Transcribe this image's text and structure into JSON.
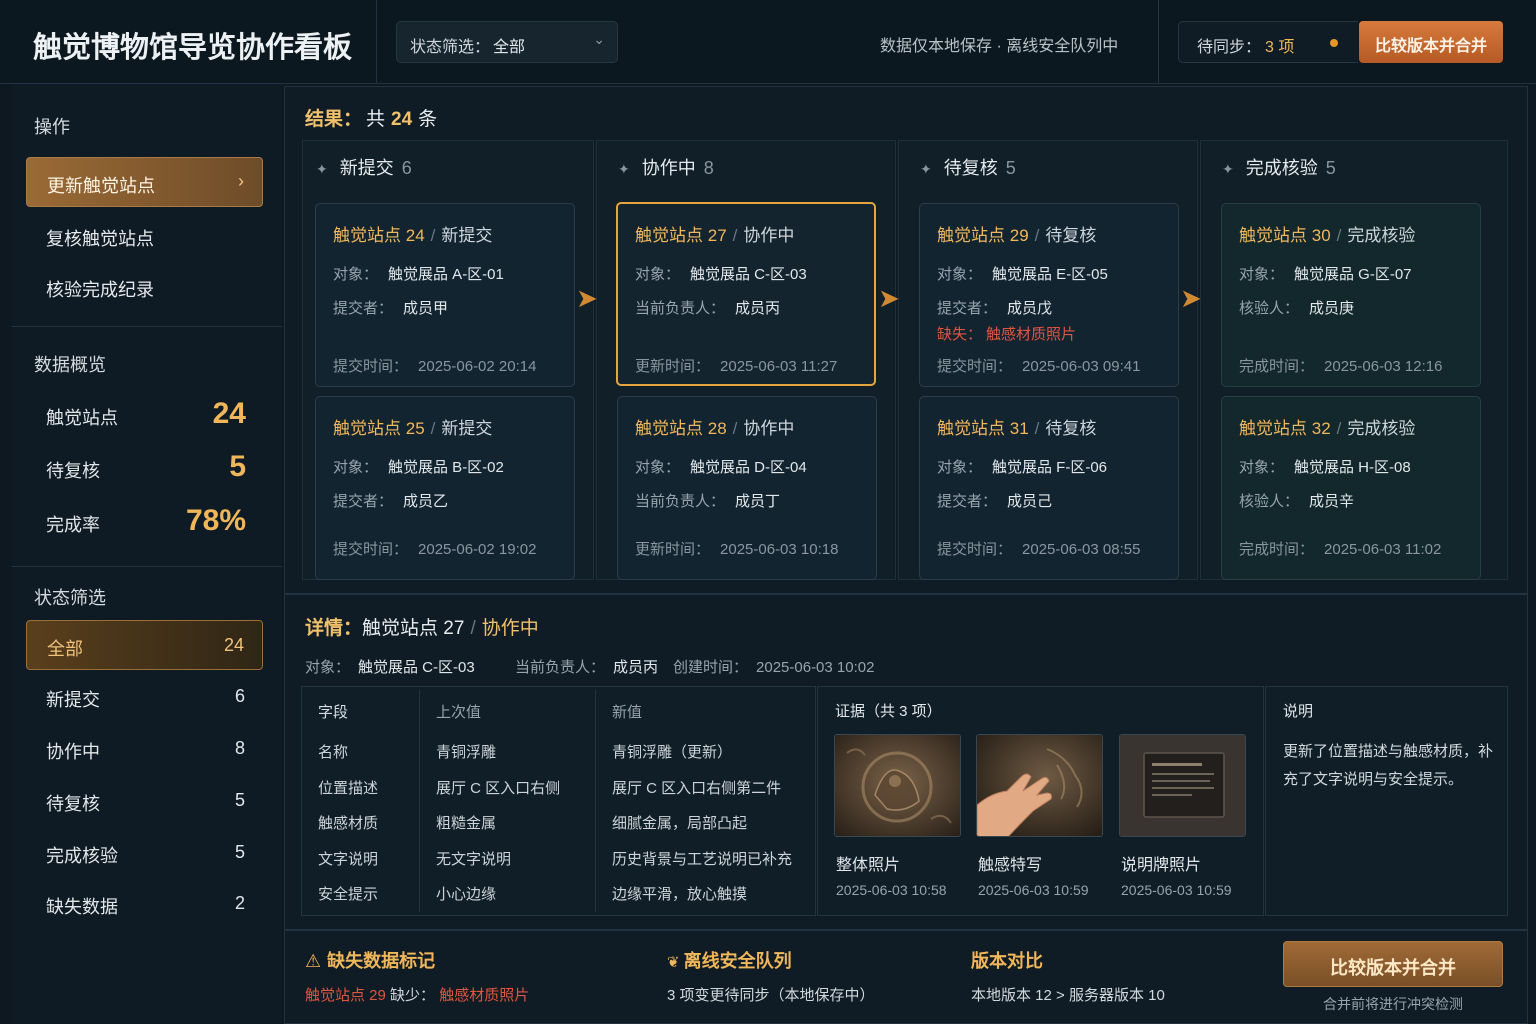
{
  "app": {
    "title": "触觉博物馆导览协作看板"
  },
  "topbar": {
    "filter_label": "状态筛选：",
    "filter_value": "全部",
    "notice": "数据仅本地保存 · 离线安全队列中",
    "pending_label": "待同步：",
    "pending_count": "3 项",
    "compare_button": "比较版本并合并"
  },
  "sidebar": {
    "actions_title": "操作",
    "actions": [
      {
        "label": "更新触觉站点"
      },
      {
        "label": "复核触觉站点"
      },
      {
        "label": "核验完成纪录"
      }
    ],
    "overview_title": "数据概览",
    "stats": [
      {
        "label": "触觉站点",
        "value": "24"
      },
      {
        "label": "待复核",
        "value": "5"
      },
      {
        "label": "完成率",
        "value": "78%"
      }
    ],
    "filter_title": "状态筛选",
    "filters": [
      {
        "label": "全部",
        "count": "24"
      },
      {
        "label": "新提交",
        "count": "6"
      },
      {
        "label": "协作中",
        "count": "8"
      },
      {
        "label": "待复核",
        "count": "5"
      },
      {
        "label": "完成核验",
        "count": "5"
      },
      {
        "label": "缺失数据",
        "count": "2"
      }
    ]
  },
  "results": {
    "label": "结果：",
    "total": "共",
    "count": "24",
    "unit": "条"
  },
  "columns": [
    {
      "name": "新提交",
      "count": "6",
      "cards": [
        {
          "site": "触觉站点",
          "num": "24",
          "status": "新提交",
          "rows": [
            [
              "对象：",
              "触觉展品 A-区-01"
            ],
            [
              "提交者：",
              "成员甲"
            ]
          ],
          "time_label": "提交时间：",
          "time": "2025-06-02 20:14"
        },
        {
          "site": "触觉站点",
          "num": "25",
          "status": "新提交",
          "rows": [
            [
              "对象：",
              "触觉展品 B-区-02"
            ],
            [
              "提交者：",
              "成员乙"
            ]
          ],
          "time_label": "提交时间：",
          "time": "2025-06-02 19:02"
        }
      ]
    },
    {
      "name": "协作中",
      "count": "8",
      "cards": [
        {
          "site": "触觉站点",
          "num": "27",
          "status": "协作中",
          "rows": [
            [
              "对象：",
              "触觉展品 C-区-03"
            ],
            [
              "当前负责人：",
              "成员丙"
            ]
          ],
          "time_label": "更新时间：",
          "time": "2025-06-03 11:27"
        },
        {
          "site": "触觉站点",
          "num": "28",
          "status": "协作中",
          "rows": [
            [
              "对象：",
              "触觉展品 D-区-04"
            ],
            [
              "当前负责人：",
              "成员丁"
            ]
          ],
          "time_label": "更新时间：",
          "time": "2025-06-03 10:18"
        }
      ]
    },
    {
      "name": "待复核",
      "count": "5",
      "cards": [
        {
          "site": "触觉站点",
          "num": "29",
          "status": "待复核",
          "rows": [
            [
              "对象：",
              "触觉展品 E-区-05"
            ],
            [
              "提交者：",
              "成员戊"
            ]
          ],
          "missing_label": "缺失：",
          "missing": "触感材质照片",
          "time_label": "提交时间：",
          "time": "2025-06-03 09:41"
        },
        {
          "site": "触觉站点",
          "num": "31",
          "status": "待复核",
          "rows": [
            [
              "对象：",
              "触觉展品 F-区-06"
            ],
            [
              "提交者：",
              "成员己"
            ]
          ],
          "time_label": "提交时间：",
          "time": "2025-06-03 08:55"
        }
      ]
    },
    {
      "name": "完成核验",
      "count": "5",
      "cards": [
        {
          "site": "触觉站点",
          "num": "30",
          "status": "完成核验",
          "rows": [
            [
              "对象：",
              "触觉展品 G-区-07"
            ],
            [
              "核验人：",
              "成员庚"
            ]
          ],
          "time_label": "完成时间：",
          "time": "2025-06-03 12:16"
        },
        {
          "site": "触觉站点",
          "num": "32",
          "status": "完成核验",
          "rows": [
            [
              "对象：",
              "触觉展品 H-区-08"
            ],
            [
              "核验人：",
              "成员辛"
            ]
          ],
          "time_label": "完成时间：",
          "time": "2025-06-03 11:02"
        }
      ]
    }
  ],
  "detail": {
    "label": "详情：",
    "site": "触觉站点 27",
    "status": "协作中",
    "object_label": "对象：",
    "object": "触觉展品 C-区-03",
    "owner_label": "当前负责人：",
    "owner": "成员丙",
    "created_label": "创建时间：",
    "created": "2025-06-03 10:02",
    "table_headers": [
      "字段",
      "上次值",
      "新值"
    ],
    "table_rows": [
      [
        "名称",
        "青铜浮雕",
        "青铜浮雕（更新）"
      ],
      [
        "位置描述",
        "展厅 C 区入口右侧",
        "展厅 C 区入口右侧第二件"
      ],
      [
        "触感材质",
        "粗糙金属",
        "细腻金属，局部凸起"
      ],
      [
        "文字说明",
        "无文字说明",
        "历史背景与工艺说明已补充"
      ],
      [
        "安全提示",
        "小心边缘",
        "边缘平滑，放心触摸"
      ]
    ],
    "evidence_title": "证据（共 3 项）",
    "evidence": [
      {
        "name": "整体照片",
        "time": "2025-06-03 10:58"
      },
      {
        "name": "触感特写",
        "time": "2025-06-03 10:59"
      },
      {
        "name": "说明牌照片",
        "time": "2025-06-03 10:59"
      }
    ],
    "note_title": "说明",
    "note": "更新了位置描述与触感材质，补充了文字说明与安全提示。"
  },
  "footer": {
    "missing_title": "缺失数据标记",
    "missing_site": "触觉站点 29",
    "missing_mid": "缺少：",
    "missing_item": "触感材质照片",
    "queue_title": "离线安全队列",
    "queue_text": "3 项变更待同步（本地保存中）",
    "version_title": "版本对比",
    "version_text": "本地版本 12 > 服务器版本 10",
    "merge_button": "比较版本并合并",
    "merge_note": "合并前将进行冲突检测"
  },
  "colors": {
    "accent": "#f0b65a",
    "button": "#c8692f",
    "missing": "#e0553f",
    "background": "#0d1820"
  }
}
